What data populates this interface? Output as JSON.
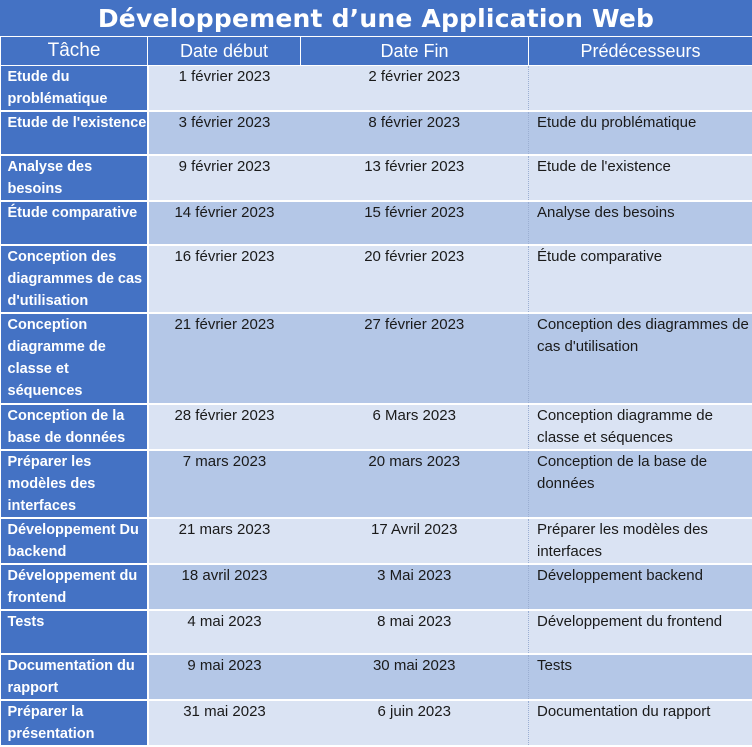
{
  "title": "Développement d’une Application Web",
  "headers": [
    "Tâche",
    "Date début",
    "Date Fin",
    "Prédécesseurs"
  ],
  "rows": [
    {
      "task": "Etude du problématique",
      "start": "1 février 2023",
      "end": "2 février 2023",
      "pred": ""
    },
    {
      "task": "Etude de l'existence",
      "start": "3 février 2023",
      "end": "8 février 2023",
      "pred": "Etude du problématique"
    },
    {
      "task": "Analyse des besoins",
      "start": "9 février 2023",
      "end": "13 février 2023",
      "pred": "Etude de l'existence"
    },
    {
      "task": "Étude comparative",
      "start": "14 février 2023",
      "end": "15 février 2023",
      "pred": "Analyse des besoins"
    },
    {
      "task": "Conception des diagrammes de cas d'utilisation",
      "start": "16 février 2023",
      "end": "20 février 2023",
      "pred": "Étude comparative"
    },
    {
      "task": "Conception diagramme de classe et séquences",
      "start": "21 février 2023",
      "end": "27 février 2023",
      "pred": "Conception des diagrammes de cas d'utilisation"
    },
    {
      "task": "Conception de la base de données",
      "start": "28 février 2023",
      "end": "6 Mars 2023",
      "pred": "Conception diagramme de classe et séquences"
    },
    {
      "task": "Préparer les modèles des interfaces",
      "start": "7 mars 2023",
      "end": "20 mars 2023",
      "pred": "Conception de la base de données"
    },
    {
      "task": "Développement Du backend",
      "start": "21 mars 2023",
      "end": "17 Avril 2023",
      "pred": "Préparer les modèles des interfaces"
    },
    {
      "task": "Développement du frontend",
      "start": "18 avril 2023",
      "end": "3 Mai 2023",
      "pred": "Développement backend"
    },
    {
      "task": "Tests",
      "start": "4 mai 2023",
      "end": "8 mai 2023",
      "pred": "Développement du frontend"
    },
    {
      "task": "Documentation du rapport",
      "start": "9 mai 2023",
      "end": "30 mai 2023",
      "pred": "Tests"
    },
    {
      "task": "Préparer la présentation",
      "start": "31 mai 2023",
      "end": "6 juin 2023",
      "pred": "Documentation du rapport"
    }
  ]
}
